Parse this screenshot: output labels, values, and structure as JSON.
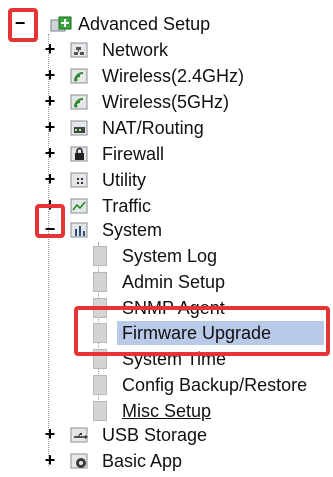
{
  "tree": {
    "root": {
      "label": "Advanced Setup",
      "toggle": "−"
    },
    "children": [
      {
        "label": "Network",
        "toggle": "+"
      },
      {
        "label": "Wireless(2.4GHz)",
        "toggle": "+"
      },
      {
        "label": "Wireless(5GHz)",
        "toggle": "+"
      },
      {
        "label": "NAT/Routing",
        "toggle": "+"
      },
      {
        "label": "Firewall",
        "toggle": "+"
      },
      {
        "label": "Utility",
        "toggle": "+"
      },
      {
        "label": "Traffic",
        "toggle": "+"
      },
      {
        "label": "System",
        "toggle": "−"
      },
      {
        "label": "USB Storage",
        "toggle": "+"
      },
      {
        "label": "Basic App",
        "toggle": "+"
      }
    ],
    "system_items": [
      {
        "label": "System Log"
      },
      {
        "label": "Admin Setup"
      },
      {
        "label": "SNMP Agent"
      },
      {
        "label": "Firmware Upgrade",
        "selected": true
      },
      {
        "label": "System Time"
      },
      {
        "label": "Config Backup/Restore"
      },
      {
        "label": "Misc Setup"
      }
    ]
  },
  "colors": {
    "highlight_box": "#e53434",
    "selection": "#b9c9e8"
  }
}
